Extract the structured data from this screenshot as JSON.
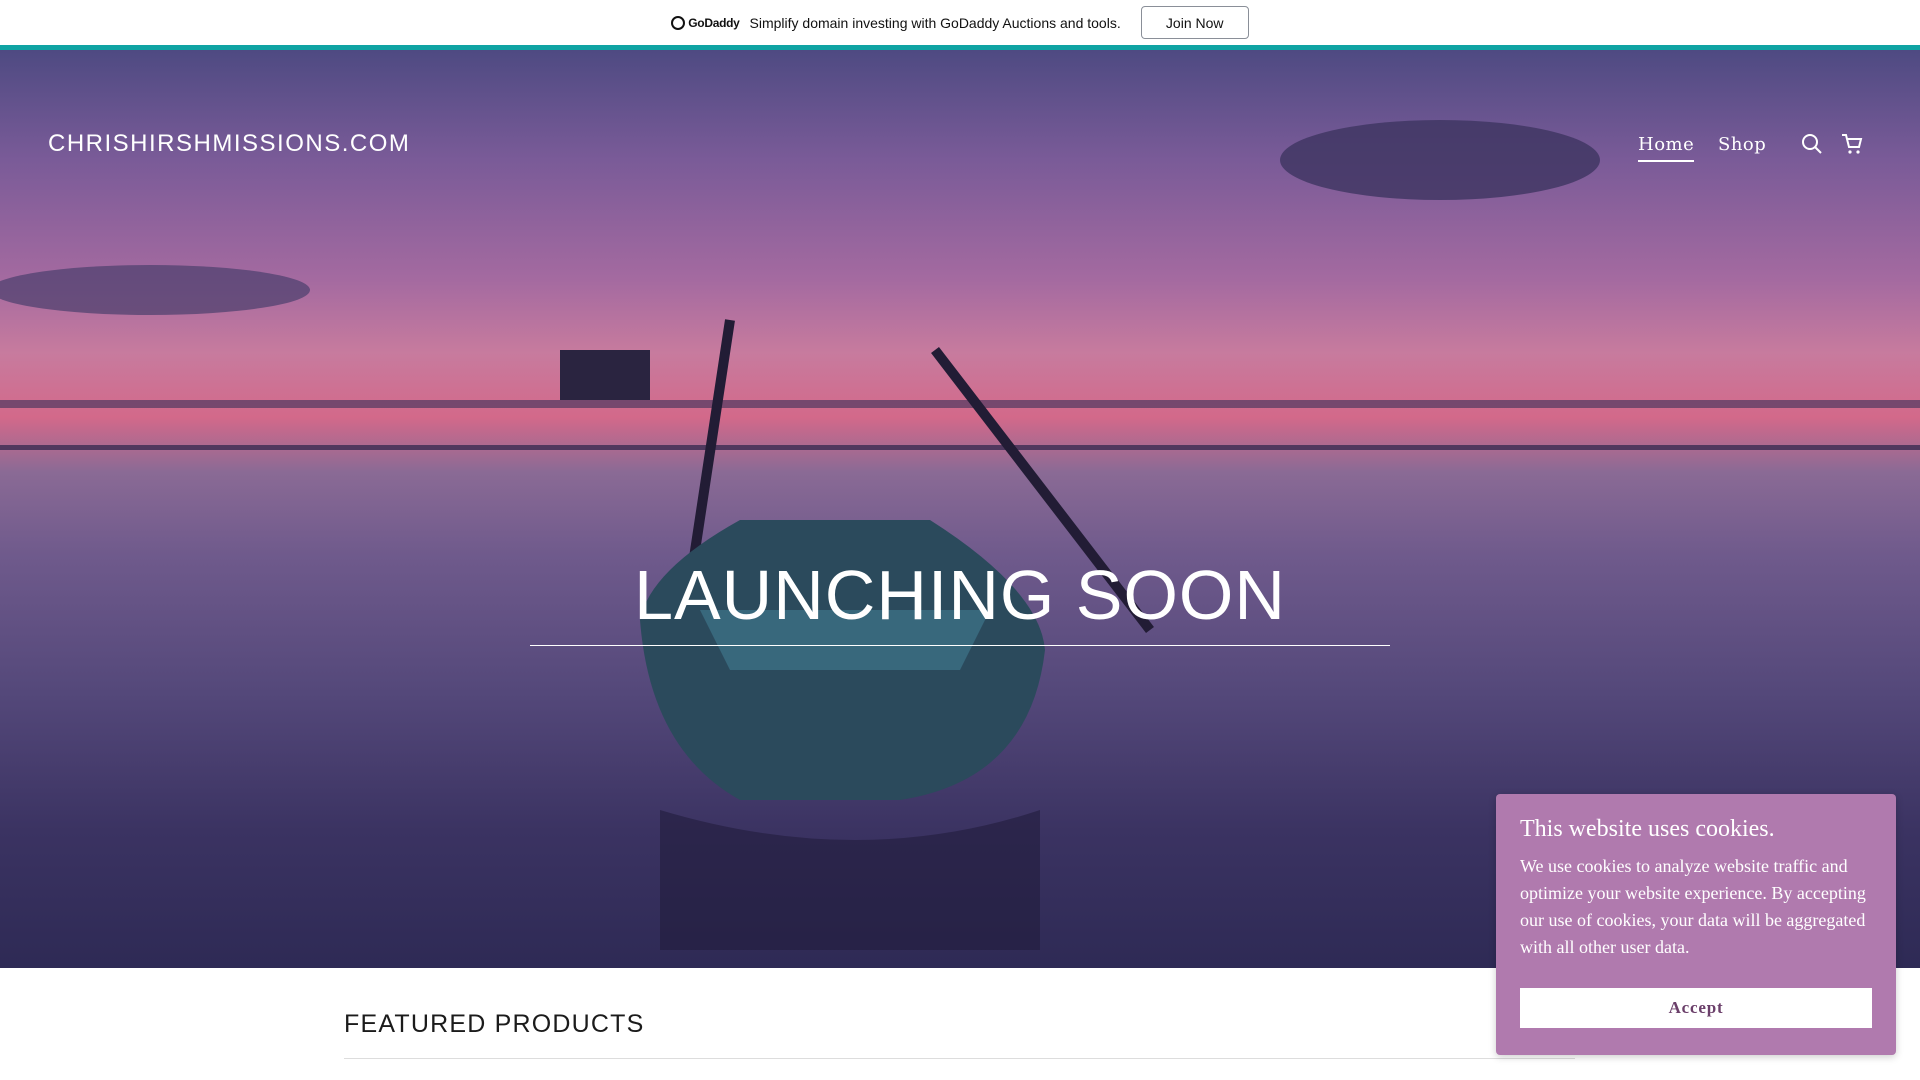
{
  "promo_bar": {
    "logo_text": "GoDaddy",
    "message": "Simplify domain investing with GoDaddy Auctions and tools.",
    "button_label": "Join Now"
  },
  "header": {
    "site_title": "CHRISHIRSHMISSIONS.COM",
    "nav": [
      {
        "label": "Home",
        "active": true
      },
      {
        "label": "Shop",
        "active": false
      }
    ],
    "icons": [
      "search-icon",
      "cart-icon"
    ]
  },
  "hero": {
    "title": "LAUNCHING SOON"
  },
  "featured": {
    "heading": "FEATURED PRODUCTS"
  },
  "cookie_banner": {
    "title": "This website uses cookies.",
    "body": "We use cookies to analyze website traffic and optimize your website experience. By accepting our use of cookies, your data will be aggregated with all other user data.",
    "accept_label": "Accept"
  },
  "colors": {
    "accent_teal": "#0fa3a3",
    "cookie_bg": "#b07aae"
  }
}
